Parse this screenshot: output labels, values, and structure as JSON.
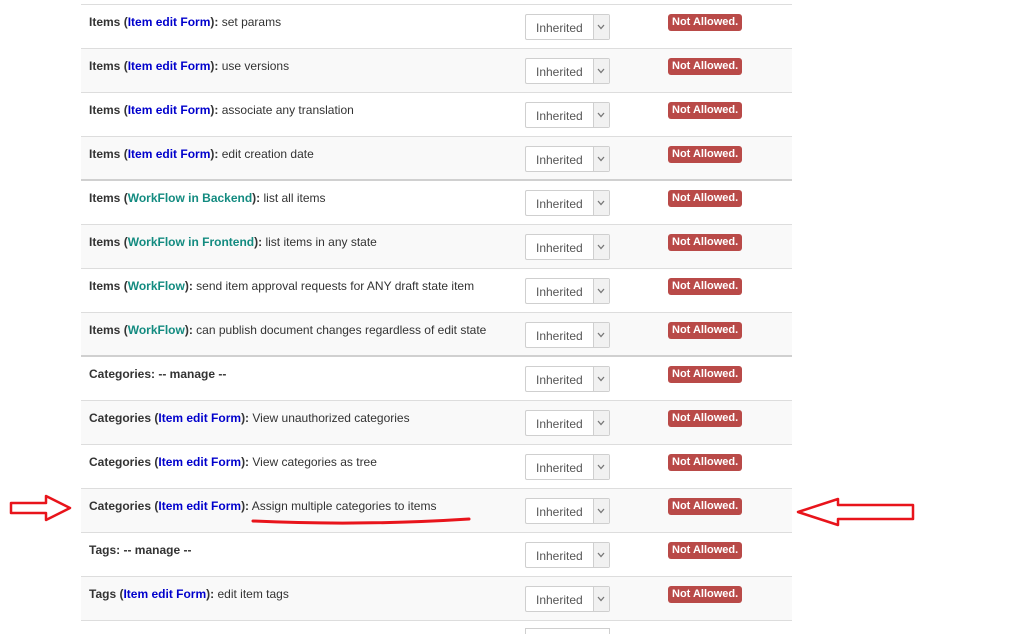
{
  "rows": [
    {
      "group": "Items",
      "open": " (",
      "link": "Item edit Form",
      "link_color": "blue",
      "close": "):",
      "text": " set params",
      "select": "Inherited",
      "status": "Not Allowed."
    },
    {
      "group": "Items",
      "open": " (",
      "link": "Item edit Form",
      "link_color": "blue",
      "close": "):",
      "text": " use versions",
      "select": "Inherited",
      "status": "Not Allowed."
    },
    {
      "group": "Items",
      "open": " (",
      "link": "Item edit Form",
      "link_color": "blue",
      "close": "):",
      "text": " associate any translation",
      "select": "Inherited",
      "status": "Not Allowed."
    },
    {
      "group": "Items",
      "open": " (",
      "link": "Item edit Form",
      "link_color": "blue",
      "close": "):",
      "text": " edit creation date",
      "select": "Inherited",
      "status": "Not Allowed."
    },
    {
      "group": "Items",
      "open": " (",
      "link": "WorkFlow in Backend",
      "link_color": "teal",
      "close": "):",
      "text": " list all items",
      "select": "Inherited",
      "status": "Not Allowed."
    },
    {
      "group": "Items",
      "open": " (",
      "link": "WorkFlow in Frontend",
      "link_color": "teal",
      "close": "):",
      "text": " list items in any state",
      "select": "Inherited",
      "status": "Not Allowed."
    },
    {
      "group": "Items",
      "open": " (",
      "link": "WorkFlow",
      "link_color": "teal",
      "close": "):",
      "text": " send item approval requests for ANY draft state item",
      "select": "Inherited",
      "status": "Not Allowed."
    },
    {
      "group": "Items",
      "open": " (",
      "link": "WorkFlow",
      "link_color": "teal",
      "close": "):",
      "text": " can publish document changes regardless of edit state",
      "select": "Inherited",
      "status": "Not Allowed."
    },
    {
      "group": "Categories: -- manage --",
      "open": "",
      "link": "",
      "link_color": "",
      "close": "",
      "text": "",
      "select": "Inherited",
      "status": "Not Allowed."
    },
    {
      "group": "Categories",
      "open": " (",
      "link": "Item edit Form",
      "link_color": "blue",
      "close": "):",
      "text": " View unauthorized categories",
      "select": "Inherited",
      "status": "Not Allowed."
    },
    {
      "group": "Categories",
      "open": " (",
      "link": "Item edit Form",
      "link_color": "blue",
      "close": "):",
      "text": " View categories as tree",
      "select": "Inherited",
      "status": "Not Allowed."
    },
    {
      "group": "Categories",
      "open": " (",
      "link": "Item edit Form",
      "link_color": "blue",
      "close": "):",
      "text": " Assign multiple categories to items",
      "select": "Inherited",
      "status": "Not Allowed."
    },
    {
      "group": "Tags: -- manage --",
      "open": "",
      "link": "",
      "link_color": "",
      "close": "",
      "text": "",
      "select": "Inherited",
      "status": "Not Allowed."
    },
    {
      "group": "Tags",
      "open": " (",
      "link": "Item edit Form",
      "link_color": "blue",
      "close": "):",
      "text": " edit item tags",
      "select": "Inherited",
      "status": "Not Allowed."
    }
  ],
  "annotation": {
    "highlighted_row": 11,
    "color": "#e8141b"
  }
}
